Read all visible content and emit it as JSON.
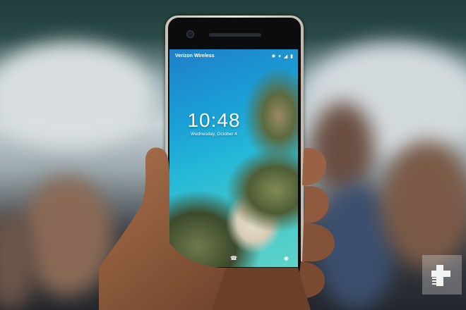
{
  "phone": {
    "carrier": "Verizon Wireless",
    "status_icons": "✱ ▾ ◢ ▮",
    "time": "10:48",
    "date": "Wednesday, October 4",
    "left_lock_icon": "mic-icon",
    "center_lock_icon": "phone-icon",
    "right_lock_icon": "camera-icon"
  },
  "watermark": {
    "icon": "plus-logo-icon"
  },
  "colors": {
    "phone_frame": "#e6dfd3",
    "screen_sea": "#1fa3d6",
    "skin": "#8a5a3c"
  }
}
